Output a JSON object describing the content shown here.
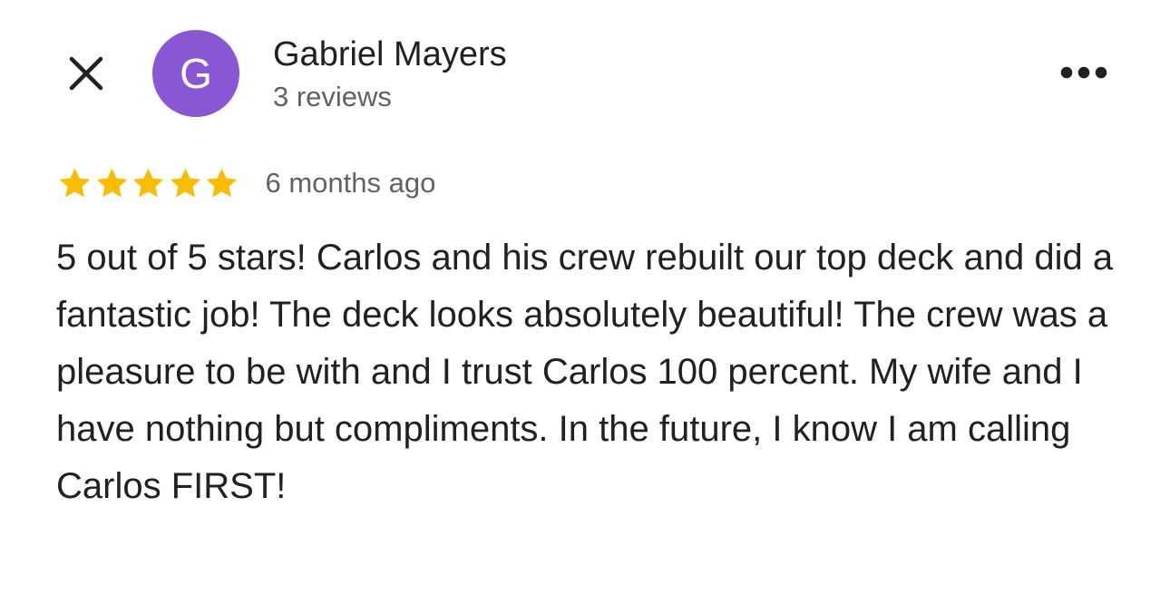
{
  "header": {
    "close_icon": "close-icon",
    "avatar_initial": "G",
    "avatar_color": "#8957d3",
    "reviewer_name": "Gabriel Mayers",
    "reviews_count": "3 reviews",
    "more_icon": "more-horizontal-icon"
  },
  "review": {
    "rating": 5,
    "max_rating": 5,
    "star_color": "#fbbc04",
    "date": "6 months ago",
    "text": "5 out of 5 stars! Carlos and his crew rebuilt our top deck and did a fantastic job! The deck looks absolutely beautiful! The crew was a pleasure to be with and I trust Carlos 100 percent. My wife and I have nothing but compliments. In the future, I know I am calling Carlos FIRST!"
  }
}
